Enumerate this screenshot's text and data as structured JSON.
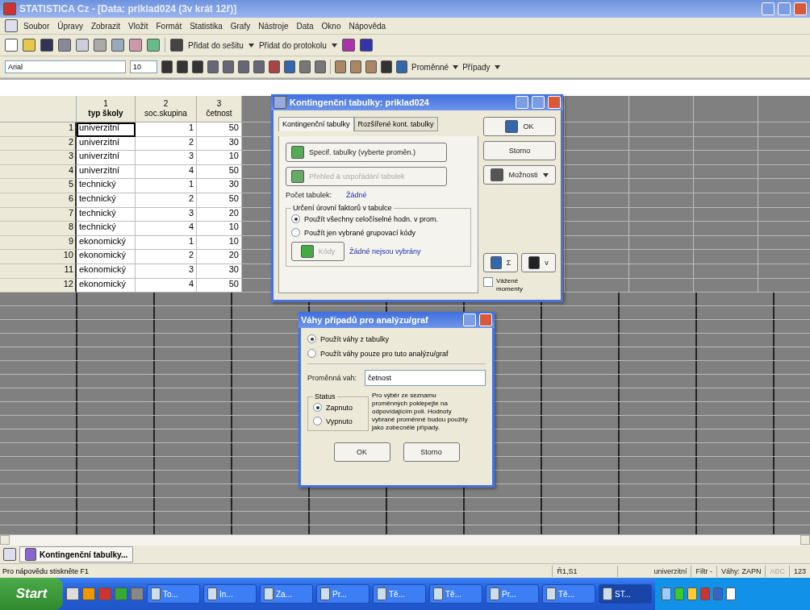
{
  "window": {
    "title": "STATISTICA Cz - [Data: priklad024 (3v krát 12ř)]"
  },
  "menu": [
    "Soubor",
    "Úpravy",
    "Zobrazit",
    "Vložit",
    "Formát",
    "Statistika",
    "Grafy",
    "Nástroje",
    "Data",
    "Okno",
    "Nápověda"
  ],
  "toolbar": {
    "add_workbook": "Přidat do sešitu",
    "add_report": "Přidat do protokolu"
  },
  "format_bar": {
    "font": "Arial",
    "size": "10",
    "variables": "Proměnné",
    "cases": "Případy"
  },
  "sheet": {
    "columns": [
      {
        "number": "1",
        "name": "typ školy"
      },
      {
        "number": "2",
        "name": "soc.skupina"
      },
      {
        "number": "3",
        "name": "četnost"
      }
    ],
    "rows": [
      {
        "number": "1",
        "cells": [
          "univerzitní",
          "1",
          "50"
        ],
        "selected": true
      },
      {
        "number": "2",
        "cells": [
          "univerzitní",
          "2",
          "30"
        ],
        "selected": false
      },
      {
        "number": "3",
        "cells": [
          "univerzitní",
          "3",
          "10"
        ],
        "selected": false
      },
      {
        "number": "4",
        "cells": [
          "univerzitní",
          "4",
          "50"
        ],
        "selected": false
      },
      {
        "number": "5",
        "cells": [
          "technický",
          "1",
          "30"
        ],
        "selected": false
      },
      {
        "number": "6",
        "cells": [
          "technický",
          "2",
          "50"
        ],
        "selected": false
      },
      {
        "number": "7",
        "cells": [
          "technický",
          "3",
          "20"
        ],
        "selected": false
      },
      {
        "number": "8",
        "cells": [
          "technický",
          "4",
          "10"
        ],
        "selected": false
      },
      {
        "number": "9",
        "cells": [
          "ekonomický",
          "1",
          "10"
        ],
        "selected": false
      },
      {
        "number": "10",
        "cells": [
          "ekonomický",
          "2",
          "20"
        ],
        "selected": false
      },
      {
        "number": "11",
        "cells": [
          "ekonomický",
          "3",
          "30"
        ],
        "selected": false
      },
      {
        "number": "12",
        "cells": [
          "ekonomický",
          "4",
          "50"
        ],
        "selected": false
      }
    ]
  },
  "crosstab_dialog": {
    "title": "Kontingenční tabulky: priklad024",
    "tabs": [
      {
        "label": "Kontingenční tabulky",
        "selected": true
      },
      {
        "label": "Rozšířené kont. tabulky",
        "selected": false
      }
    ],
    "spec_button": {
      "label": "Specif. tabulky (vyberte proměn.)",
      "disabled": false
    },
    "review_button": {
      "label": "Přehled & uspořádání tabulek",
      "disabled": true
    },
    "count_label": "Počet tabulek:",
    "count_value": "Žádné",
    "group_title": "Určení úrovní faktorů v tabulce",
    "options": [
      {
        "label": "Použít všechny celočíselné hodn. v prom.",
        "selected": true
      },
      {
        "label": "Použít jen vybrané grupovací kódy",
        "selected": false
      }
    ],
    "codes_button": {
      "label": "Kódy",
      "disabled": true
    },
    "codes_note": "Žádné nejsou vybrány",
    "ok": "OK",
    "cancel": "Storno",
    "options_button": "Možnosti",
    "sum_label": "Σ",
    "weights_label": "v",
    "weighted_moments": {
      "label": "Vážené momenty",
      "checked": false
    }
  },
  "weights_dialog": {
    "title": "Váhy případů pro analýzu/graf",
    "options": [
      {
        "label": "Použít váhy z tabulky",
        "selected": true
      },
      {
        "label": "Použít váhy pouze pro tuto analýzu/graf",
        "selected": false
      }
    ],
    "variable_label": "Proměnná vah:",
    "variable_value": "četnost",
    "status_title": "Status",
    "status": [
      {
        "label": "Zapnuto",
        "selected": true
      },
      {
        "label": "Vypnuto",
        "selected": false
      }
    ],
    "note": "Pro výběr ze seznamu proměnných poklepejte na odpovídajícím poli. Hodnoty vybrané proměnné budou použity jako zobecnělé případy.",
    "ok": "OK",
    "cancel": "Storno"
  },
  "workbook_tab": {
    "label": "Kontingenční tabulky..."
  },
  "status_bar": {
    "hint": "Pro nápovědu stiskněte F1",
    "position": "Ř1,S1",
    "value": "univerzitní",
    "filter": "Filtr -",
    "weights": "Váhy: ZAPN",
    "indicators": [
      {
        "label": "ABC",
        "on": false
      },
      {
        "label": "123",
        "on": true
      }
    ]
  },
  "taskbar": {
    "start": "Start",
    "tasks": [
      {
        "label": "To...",
        "selected": false
      },
      {
        "label": "In...",
        "selected": false
      },
      {
        "label": "Za...",
        "selected": false
      },
      {
        "label": "Pr...",
        "selected": false
      },
      {
        "label": "Tě...",
        "selected": false
      },
      {
        "label": "Tě...",
        "selected": false
      },
      {
        "label": "Pr...",
        "selected": false
      },
      {
        "label": "Tě...",
        "selected": false
      },
      {
        "label": "ST...",
        "selected": true
      }
    ]
  }
}
